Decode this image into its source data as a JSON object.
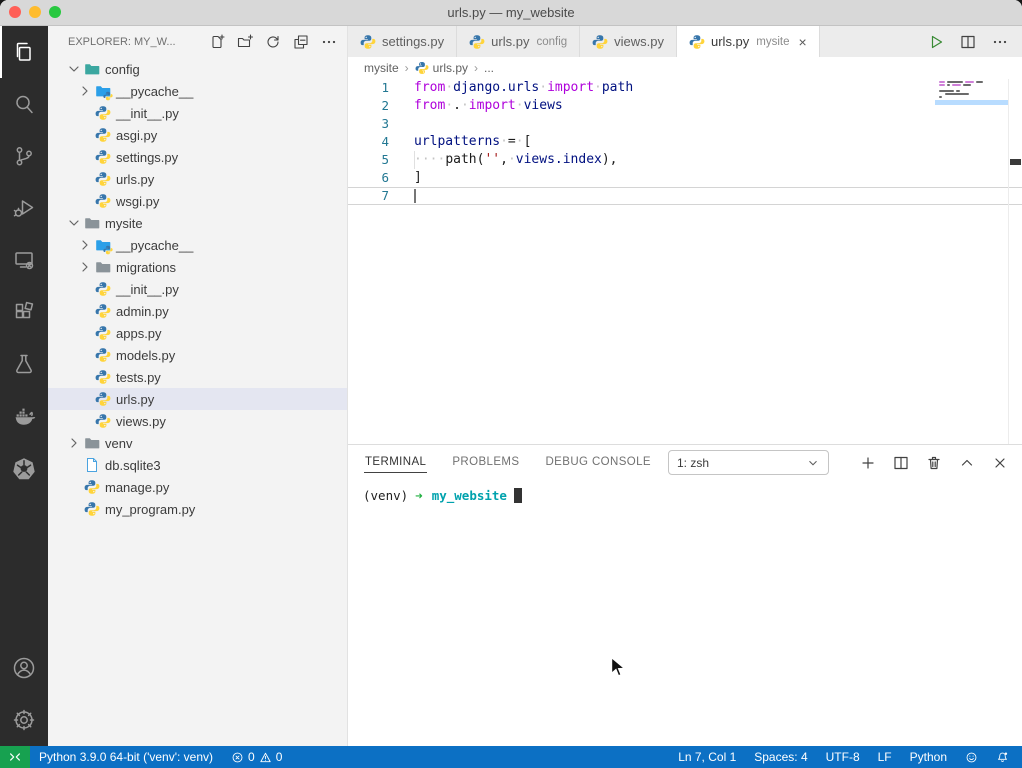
{
  "window": {
    "title": "urls.py — my_website"
  },
  "activity_bar": {
    "top": [
      {
        "icon": "files-icon",
        "active": true
      },
      {
        "icon": "search-icon"
      },
      {
        "icon": "source-control-icon"
      },
      {
        "icon": "run-debug-icon"
      },
      {
        "icon": "remote-explorer-icon"
      },
      {
        "icon": "extensions-icon"
      },
      {
        "icon": "test-beaker-icon"
      },
      {
        "icon": "docker-icon"
      },
      {
        "icon": "kubernetes-icon"
      }
    ],
    "bottom": [
      {
        "icon": "account-icon"
      },
      {
        "icon": "settings-gear-icon"
      }
    ]
  },
  "sidebar": {
    "header": {
      "title": "EXPLORER: MY_W...",
      "actions": [
        "new-file-icon",
        "new-folder-icon",
        "refresh-explorer-icon",
        "collapse-folders-icon",
        "more-actions-icon"
      ]
    },
    "tree": [
      {
        "label": "config",
        "icon": "folder-config-icon",
        "chevron": "down",
        "indent": 0
      },
      {
        "label": "__pycache__",
        "icon": "folder-python-icon",
        "chevron": "right",
        "indent": 1
      },
      {
        "label": "__init__.py",
        "icon": "python-icon",
        "indent": 1
      },
      {
        "label": "asgi.py",
        "icon": "python-icon",
        "indent": 1
      },
      {
        "label": "settings.py",
        "icon": "python-icon",
        "indent": 1
      },
      {
        "label": "urls.py",
        "icon": "python-icon",
        "indent": 1
      },
      {
        "label": "wsgi.py",
        "icon": "python-icon",
        "indent": 1
      },
      {
        "label": "mysite",
        "icon": "folder-gray-icon",
        "chevron": "down",
        "indent": 0
      },
      {
        "label": "__pycache__",
        "icon": "folder-python-icon",
        "chevron": "right",
        "indent": 1
      },
      {
        "label": "migrations",
        "icon": "folder-gray-icon",
        "chevron": "right",
        "indent": 1
      },
      {
        "label": "__init__.py",
        "icon": "python-icon",
        "indent": 1
      },
      {
        "label": "admin.py",
        "icon": "python-icon",
        "indent": 1
      },
      {
        "label": "apps.py",
        "icon": "python-icon",
        "indent": 1
      },
      {
        "label": "models.py",
        "icon": "python-icon",
        "indent": 1
      },
      {
        "label": "tests.py",
        "icon": "python-icon",
        "indent": 1
      },
      {
        "label": "urls.py",
        "icon": "python-icon",
        "indent": 1,
        "selected": true
      },
      {
        "label": "views.py",
        "icon": "python-icon",
        "indent": 1
      },
      {
        "label": "venv",
        "icon": "folder-gray-icon",
        "chevron": "right",
        "indent": 0
      },
      {
        "label": "db.sqlite3",
        "icon": "database-file-icon",
        "indent": 0
      },
      {
        "label": "manage.py",
        "icon": "python-icon",
        "indent": 0
      },
      {
        "label": "my_program.py",
        "icon": "python-icon",
        "indent": 0
      }
    ]
  },
  "editor": {
    "tabs": [
      {
        "label": "settings.py",
        "icon": "python-icon"
      },
      {
        "label": "urls.py",
        "description": "config",
        "icon": "python-icon"
      },
      {
        "label": "views.py",
        "icon": "python-icon"
      },
      {
        "label": "urls.py",
        "description": "mysite",
        "icon": "python-icon",
        "active": true,
        "close": "×"
      }
    ],
    "actions": [
      {
        "icon": "run-python-file-icon",
        "kind": "run"
      },
      {
        "icon": "split-editor-icon",
        "kind": "plain"
      },
      {
        "icon": "more-actions-icon",
        "kind": "plain"
      }
    ],
    "breadcrumb": [
      {
        "label": "mysite"
      },
      {
        "label": "urls.py",
        "icon": "python-icon"
      },
      {
        "label": "..."
      }
    ],
    "breadcrumb_separator": "›",
    "code": {
      "lines": [
        {
          "num": "1",
          "segments": [
            {
              "c": "k",
              "t": "from"
            },
            {
              "c": "w",
              "t": "·"
            },
            {
              "c": "v",
              "t": "django.urls"
            },
            {
              "c": "w",
              "t": "·"
            },
            {
              "c": "k",
              "t": "import"
            },
            {
              "c": "w",
              "t": "·"
            },
            {
              "c": "v",
              "t": "path"
            }
          ]
        },
        {
          "num": "2",
          "segments": [
            {
              "c": "k",
              "t": "from"
            },
            {
              "c": "w",
              "t": "·"
            },
            {
              "c": "p",
              "t": "."
            },
            {
              "c": "w",
              "t": "·"
            },
            {
              "c": "k",
              "t": "import"
            },
            {
              "c": "w",
              "t": "·"
            },
            {
              "c": "v",
              "t": "views"
            }
          ]
        },
        {
          "num": "3",
          "segments": []
        },
        {
          "num": "4",
          "segments": [
            {
              "c": "v",
              "t": "urlpatterns"
            },
            {
              "c": "w",
              "t": "·"
            },
            {
              "c": "p",
              "t": "="
            },
            {
              "c": "w",
              "t": "·"
            },
            {
              "c": "p",
              "t": "["
            }
          ]
        },
        {
          "num": "5",
          "guide": true,
          "segments": [
            {
              "c": "w",
              "t": "····"
            },
            {
              "c": "p",
              "t": "path("
            },
            {
              "c": "s",
              "t": "''"
            },
            {
              "c": "p",
              "t": ","
            },
            {
              "c": "w",
              "t": "·"
            },
            {
              "c": "v",
              "t": "views.index"
            },
            {
              "c": "p",
              "t": "),"
            }
          ]
        },
        {
          "num": "6",
          "segments": [
            {
              "c": "p",
              "t": "]"
            }
          ]
        },
        {
          "num": "7",
          "current": true,
          "segments": []
        }
      ]
    }
  },
  "panel": {
    "tabs": [
      {
        "label": "TERMINAL",
        "active": true
      },
      {
        "label": "PROBLEMS"
      },
      {
        "label": "DEBUG CONSOLE"
      }
    ],
    "dropdown": {
      "value": "1: zsh"
    },
    "actions": [
      "new-terminal-icon",
      "split-terminal-icon",
      "kill-terminal-icon",
      "maximize-panel-icon",
      "close-panel-icon"
    ],
    "terminal": {
      "venv": "(venv)",
      "arrow": "➜",
      "cwd": "my_website"
    }
  },
  "status_bar": {
    "interpreter": "Python 3.9.0 64-bit ('venv': venv)",
    "errors": "0",
    "warnings": "0",
    "right": [
      {
        "label": "Ln 7, Col 1",
        "name": "cursor-position"
      },
      {
        "label": "Spaces: 4",
        "name": "indentation"
      },
      {
        "label": "UTF-8",
        "name": "encoding"
      },
      {
        "label": "LF",
        "name": "eol"
      },
      {
        "label": "Python",
        "name": "language-mode"
      }
    ]
  },
  "colors": {
    "status_blue": "#0c70c4",
    "remote_green": "#17a150",
    "keyword": "#af00db",
    "identifier": "#001080",
    "string": "#a31515",
    "selected_row": "#e4e6f1"
  }
}
